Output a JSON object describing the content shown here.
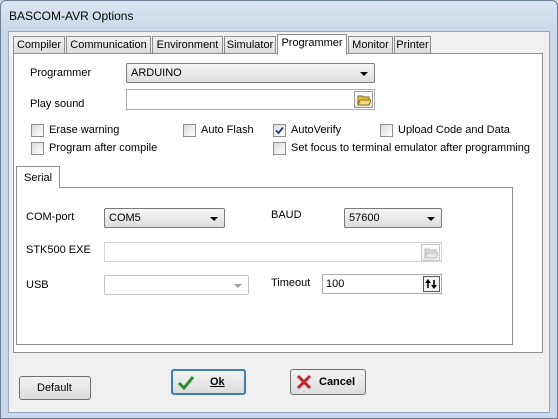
{
  "window": {
    "title": "BASCOM-AVR Options"
  },
  "tabs": [
    "Compiler",
    "Communication",
    "Environment",
    "Simulator",
    "Programmer",
    "Monitor",
    "Printer"
  ],
  "active_tab": "Programmer",
  "programmer": {
    "programmer_label": "Programmer",
    "programmer_value": "ARDUINO",
    "play_sound_label": "Play sound",
    "play_sound_value": ""
  },
  "options": {
    "erase_warning": {
      "label": "Erase warning",
      "checked": false
    },
    "auto_flash": {
      "label": "Auto Flash",
      "checked": false
    },
    "auto_verify": {
      "label": "AutoVerify",
      "checked": true
    },
    "upload_code_data": {
      "label": "Upload Code and Data",
      "checked": false
    },
    "program_after_compile": {
      "label": "Program after compile",
      "checked": false
    },
    "set_focus_terminal": {
      "label": "Set focus to terminal emulator after programming",
      "checked": false
    }
  },
  "serial": {
    "tab_label": "Serial",
    "comport_label": "COM-port",
    "comport_value": "COM5",
    "baud_label": "BAUD",
    "baud_value": "57600",
    "stk500_label": "STK500 EXE",
    "stk500_value": "",
    "usb_label": "USB",
    "usb_value": "",
    "timeout_label": "Timeout",
    "timeout_value": "100"
  },
  "buttons": {
    "default": "Default",
    "ok": "Ok",
    "cancel": "Cancel"
  },
  "colors": {
    "ok_check": "#2e8b2e",
    "cancel_x": "#c0282d",
    "checkmark": "#1d3f8a"
  }
}
